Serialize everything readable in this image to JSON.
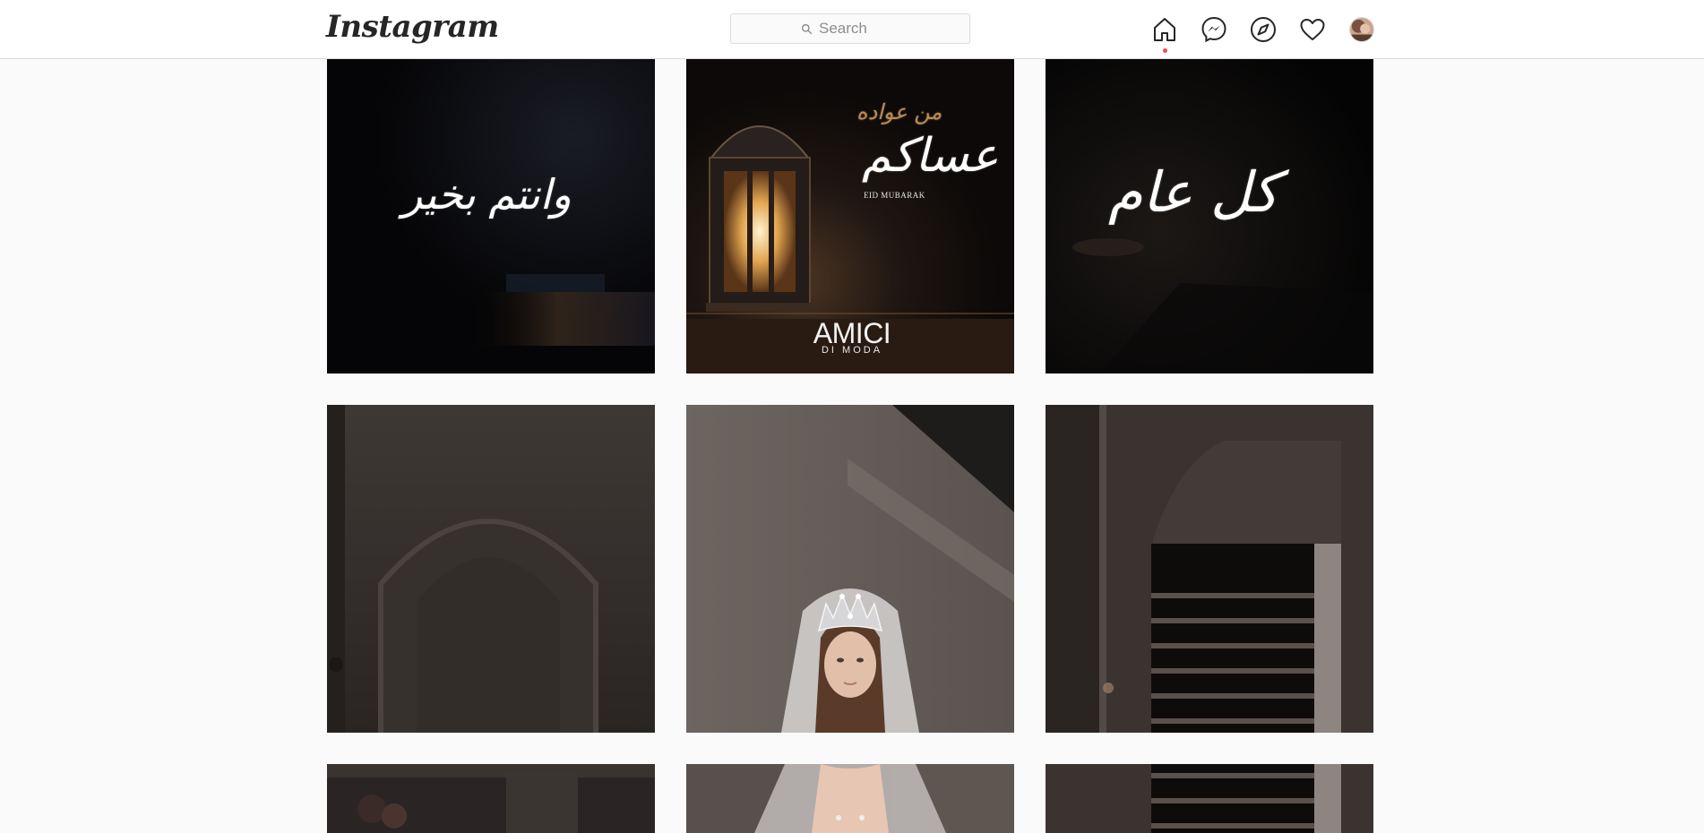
{
  "app": {
    "logo": "Instagram"
  },
  "search": {
    "placeholder": "Search"
  },
  "nav": {
    "icons": [
      "home-icon",
      "messenger-icon",
      "explore-icon",
      "activity-heart-icon",
      "profile-avatar"
    ],
    "notification_color": "#ed4956"
  },
  "posts": {
    "row1": {
      "post1": {
        "text": "وانتم بخير"
      },
      "post2": {
        "text_top": "من عواده",
        "text_main": "عساكم",
        "subtitle": "EID MUBARAK",
        "brand": "AMICI",
        "brand_sub": "DI MODA"
      },
      "post3": {
        "text": "كل عام"
      }
    },
    "row2": {
      "post1": {
        "scene": "dark-arch"
      },
      "post2": {
        "scene": "bride-with-crown"
      },
      "post3": {
        "scene": "staircase"
      }
    },
    "row3": {
      "post1": {
        "scene": "dark-room"
      },
      "post2": {
        "scene": "bride-dress"
      },
      "post3": {
        "scene": "staircase"
      }
    }
  }
}
